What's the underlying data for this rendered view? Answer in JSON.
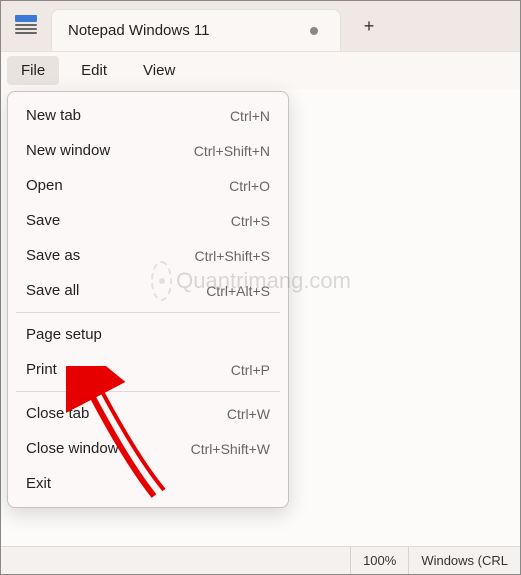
{
  "titlebar": {
    "tab_title": "Notepad Windows 11"
  },
  "menubar": {
    "file": "File",
    "edit": "Edit",
    "view": "View"
  },
  "file_menu": {
    "new_tab": {
      "label": "New tab",
      "shortcut": "Ctrl+N"
    },
    "new_window": {
      "label": "New window",
      "shortcut": "Ctrl+Shift+N"
    },
    "open": {
      "label": "Open",
      "shortcut": "Ctrl+O"
    },
    "save": {
      "label": "Save",
      "shortcut": "Ctrl+S"
    },
    "save_as": {
      "label": "Save as",
      "shortcut": "Ctrl+Shift+S"
    },
    "save_all": {
      "label": "Save all",
      "shortcut": "Ctrl+Alt+S"
    },
    "page_setup": {
      "label": "Page setup",
      "shortcut": ""
    },
    "print": {
      "label": "Print",
      "shortcut": "Ctrl+P"
    },
    "close_tab": {
      "label": "Close tab",
      "shortcut": "Ctrl+W"
    },
    "close_window": {
      "label": "Close window",
      "shortcut": "Ctrl+Shift+W"
    },
    "exit": {
      "label": "Exit",
      "shortcut": ""
    }
  },
  "statusbar": {
    "zoom": "100%",
    "eol": "Windows (CRL"
  },
  "watermark": {
    "text": "Quantrimang.com"
  }
}
